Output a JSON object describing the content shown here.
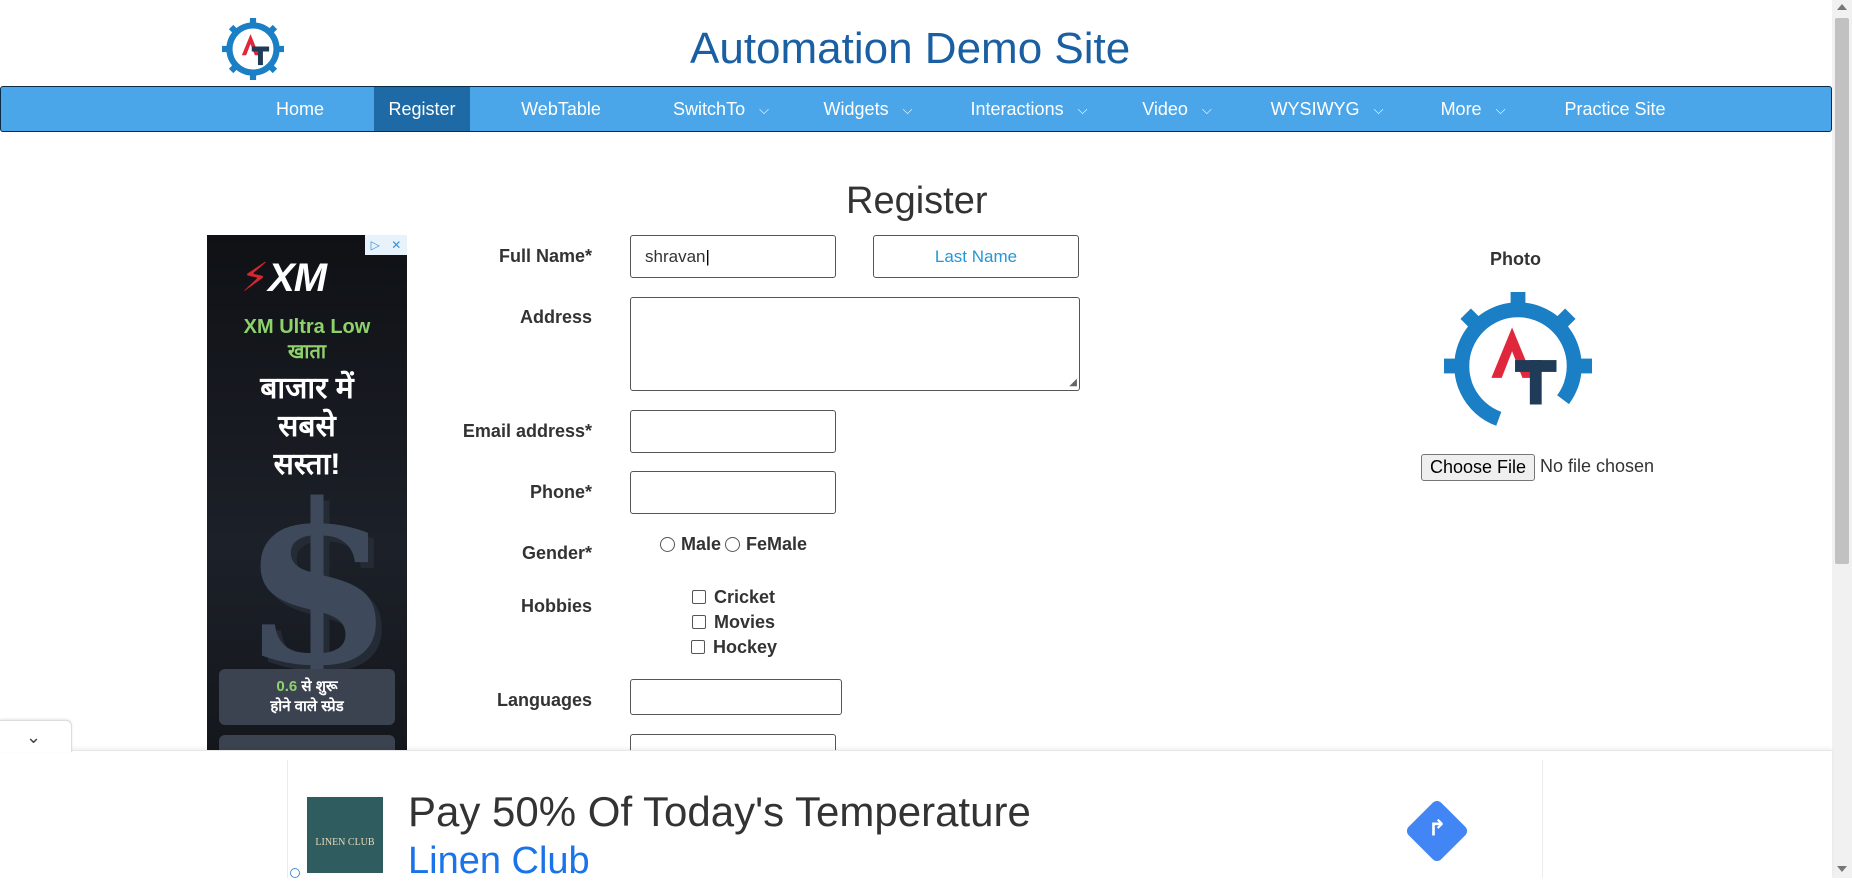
{
  "header": {
    "title": "Automation Demo Site"
  },
  "nav": [
    {
      "label": "Home",
      "has_dropdown": false,
      "active": false
    },
    {
      "label": "Register",
      "has_dropdown": false,
      "active": true
    },
    {
      "label": "WebTable",
      "has_dropdown": false,
      "active": false
    },
    {
      "label": "SwitchTo",
      "has_dropdown": true,
      "active": false
    },
    {
      "label": "Widgets",
      "has_dropdown": true,
      "active": false
    },
    {
      "label": "Interactions",
      "has_dropdown": true,
      "active": false
    },
    {
      "label": "Video",
      "has_dropdown": true,
      "active": false
    },
    {
      "label": "WYSIWYG",
      "has_dropdown": true,
      "active": false
    },
    {
      "label": "More",
      "has_dropdown": true,
      "active": false
    },
    {
      "label": "Practice Site",
      "has_dropdown": false,
      "active": false
    }
  ],
  "page": {
    "heading": "Register"
  },
  "form": {
    "full_name_label": "Full Name*",
    "first_name_value": "shravan",
    "last_name_placeholder": "Last Name",
    "address_label": "Address",
    "email_label": "Email address*",
    "phone_label": "Phone*",
    "gender_label": "Gender*",
    "gender_options": [
      "Male",
      "FeMale"
    ],
    "hobbies_label": "Hobbies",
    "hobbies": [
      "Cricket",
      "Movies",
      "Hockey"
    ],
    "languages_label": "Languages"
  },
  "photo": {
    "label": "Photo",
    "choose_file_label": "Choose File",
    "file_status": "No file chosen"
  },
  "ad_left": {
    "brand": "XM",
    "tagline_1": "XM Ultra Low\nखाता",
    "tagline_2": "बाजार में\nसबसे\nसस्ता!",
    "spread_value": "0.6",
    "spread_text": "से शुरू\nहोने वाले स्प्रेड"
  },
  "ad_bottom": {
    "headline": "Pay 50% Of Today's Temperature",
    "advertiser": "Linen Club",
    "thumb_text": "LINEN CLUB"
  },
  "colors": {
    "nav_bg": "#4aa6e8",
    "nav_active": "#1d6aa6",
    "title": "#1b5fa3",
    "accent_red": "#e0273c",
    "gear_blue": "#1b7fc6"
  }
}
